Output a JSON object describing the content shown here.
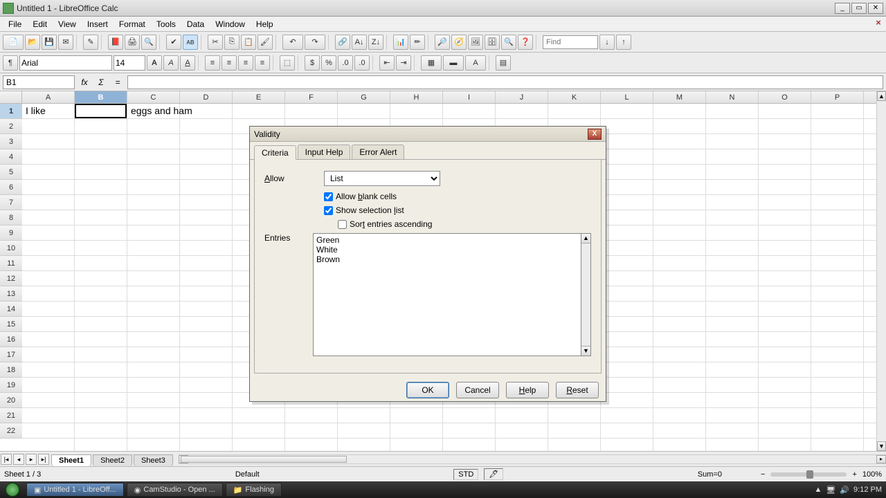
{
  "window": {
    "title": "Untitled 1 - LibreOffice Calc"
  },
  "menu": {
    "items": [
      "File",
      "Edit",
      "View",
      "Insert",
      "Format",
      "Tools",
      "Data",
      "Window",
      "Help"
    ]
  },
  "format_toolbar": {
    "font": "Arial",
    "size": "14"
  },
  "find": {
    "placeholder": "Find"
  },
  "formula_bar": {
    "name_box": "B1",
    "formula": ""
  },
  "columns": [
    "A",
    "B",
    "C",
    "D",
    "E",
    "F",
    "G",
    "H",
    "I",
    "J",
    "K",
    "L",
    "M",
    "N",
    "O",
    "P"
  ],
  "row_count": 22,
  "selected_col": "B",
  "selected_row": 1,
  "cells": {
    "A1": "I like",
    "C1": "eggs and ham"
  },
  "dialog": {
    "title": "Validity",
    "tabs": [
      "Criteria",
      "Input Help",
      "Error Alert"
    ],
    "active_tab": "Criteria",
    "allow_label": "Allow",
    "allow_value": "List",
    "allow_blank_label": "Allow blank cells",
    "allow_blank_checked": true,
    "show_selection_label": "Show selection list",
    "show_selection_checked": true,
    "sort_label": "Sort entries ascending",
    "sort_checked": false,
    "entries_label": "Entries",
    "entries_text": "Green\nWhite\nBrown",
    "buttons": {
      "ok": "OK",
      "cancel": "Cancel",
      "help": "Help",
      "reset": "Reset"
    }
  },
  "sheet_tabs": {
    "tabs": [
      "Sheet1",
      "Sheet2",
      "Sheet3"
    ],
    "active": "Sheet1"
  },
  "status": {
    "sheet": "Sheet 1 / 3",
    "style": "Default",
    "mode": "STD",
    "sum": "Sum=0",
    "zoom": "100%"
  },
  "taskbar": {
    "items": [
      {
        "label": "Untitled 1 - LibreOff...",
        "active": true
      },
      {
        "label": "CamStudio - Open ...",
        "active": false
      },
      {
        "label": "Flashing",
        "active": false
      }
    ],
    "time": "9:12 PM"
  }
}
